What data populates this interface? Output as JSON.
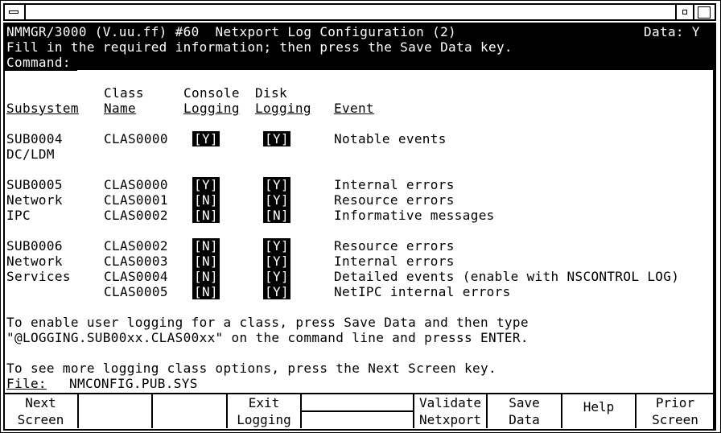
{
  "header": {
    "title": "NMMGR/3000 (V.uu.ff) #60  Netxport Log Configuration (2)",
    "data_flag": "Data: Y",
    "instruction": "Fill in the required information; then press the Save Data key.",
    "command_label": "Command:",
    "command_value": ""
  },
  "columns": {
    "subsystem": "Subsystem",
    "class_top": "Class",
    "class_bottom": "Name",
    "console_top": "Console",
    "console_bottom": "Logging",
    "disk_top": "Disk",
    "disk_bottom": "Logging",
    "event": "Event"
  },
  "rows": [
    {
      "sub": "SUB0004",
      "cls": "CLAS0000",
      "console": "Y",
      "disk": "Y",
      "event": "Notable events"
    },
    {
      "sub": "DC/LDM",
      "cls": "",
      "console": "",
      "disk": "",
      "event": ""
    },
    {
      "sub": "SUB0005",
      "cls": "CLAS0000",
      "console": "Y",
      "disk": "Y",
      "event": "Internal errors"
    },
    {
      "sub": "Network",
      "cls": "CLAS0001",
      "console": "N",
      "disk": "Y",
      "event": "Resource errors"
    },
    {
      "sub": "IPC",
      "cls": "CLAS0002",
      "console": "N",
      "disk": "N",
      "event": "Informative messages"
    },
    {
      "sub": "SUB0006",
      "cls": "CLAS0002",
      "console": "N",
      "disk": "Y",
      "event": "Resource errors"
    },
    {
      "sub": "Network",
      "cls": "CLAS0003",
      "console": "N",
      "disk": "Y",
      "event": "Internal errors"
    },
    {
      "sub": "Services",
      "cls": "CLAS0004",
      "console": "N",
      "disk": "Y",
      "event": "Detailed events (enable with NSCONTROL LOG)"
    },
    {
      "sub": "",
      "cls": "CLAS0005",
      "console": "N",
      "disk": "Y",
      "event": "NetIPC internal errors"
    }
  ],
  "notes": {
    "line1": "To enable user logging for a class, press Save Data and then type",
    "line2": "\"@LOGGING.SUB00xx.CLAS00xx\" on the command line and presss ENTER.",
    "line3": "To see more logging class options, press the Next Screen key.",
    "file_label": "File:",
    "file_value": "NMCONFIG.PUB.SYS"
  },
  "function_keys": [
    {
      "top": "Next",
      "bottom": "Screen"
    },
    {
      "top": "",
      "bottom": ""
    },
    {
      "top": "",
      "bottom": ""
    },
    {
      "top": "Exit",
      "bottom": "Logging"
    },
    {
      "top": "",
      "bottom": ""
    },
    {
      "top": "Validate",
      "bottom": "Netxport"
    },
    {
      "top": "Save",
      "bottom": "Data"
    },
    {
      "top": "Help",
      "bottom": ""
    },
    {
      "top": "Prior",
      "bottom": "Screen"
    }
  ]
}
